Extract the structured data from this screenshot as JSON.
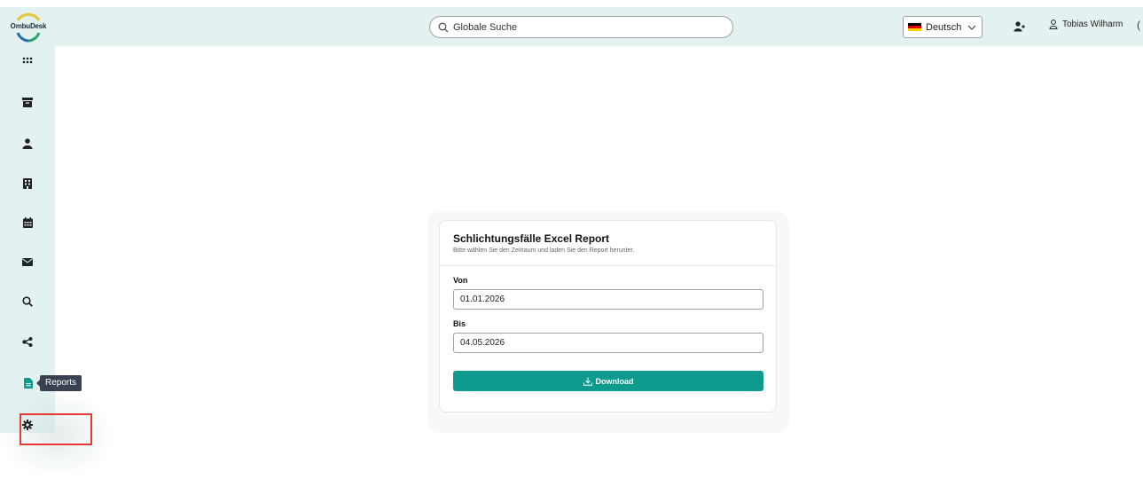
{
  "app": {
    "logo_text": "OmbuDesk"
  },
  "header": {
    "search_placeholder": "Globale Suche",
    "language": "Deutsch",
    "user_name": "Tobias Wilharm"
  },
  "sidebar": {
    "items": [
      {
        "name": "dashboard",
        "icon": "grid-icon"
      },
      {
        "name": "archive",
        "icon": "archive-icon"
      },
      {
        "name": "persons",
        "icon": "person-icon"
      },
      {
        "name": "companies",
        "icon": "building-icon"
      },
      {
        "name": "calendar",
        "icon": "calendar-icon"
      },
      {
        "name": "messages",
        "icon": "envelope-icon"
      },
      {
        "name": "search",
        "icon": "search-icon"
      },
      {
        "name": "share",
        "icon": "share-icon"
      },
      {
        "name": "reports",
        "icon": "document-icon",
        "active": true
      },
      {
        "name": "settings",
        "icon": "gear-icon"
      }
    ],
    "tooltip": "Reports"
  },
  "report_card": {
    "title": "Schlichtungsfälle Excel Report",
    "subtitle": "Bitte wählen Sie den Zeitraum und laden Sie den Report herunter.",
    "from_label": "Von",
    "from_value": "01.01.2026",
    "to_label": "Bis",
    "to_value": "04.05.2026",
    "download_label": "Download"
  },
  "colors": {
    "sidebar_bg": "#e3f1f0",
    "accent": "#0e9a8e",
    "highlight_border": "#e53935"
  }
}
